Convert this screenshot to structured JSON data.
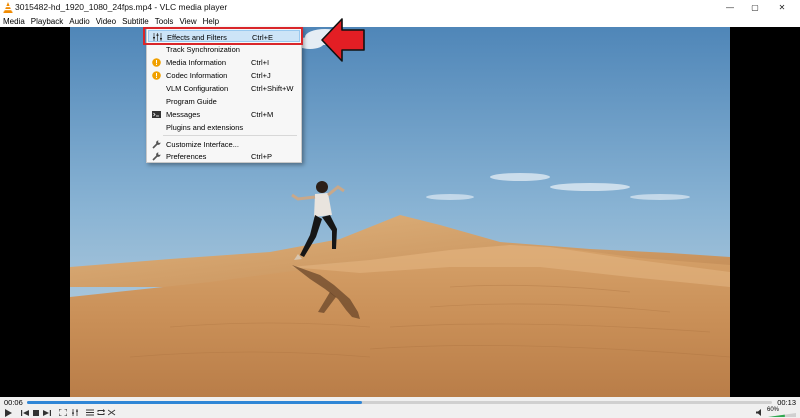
{
  "window": {
    "title": "3015482-hd_1920_1080_24fps.mp4 - VLC media player",
    "minimize_glyph": "—",
    "maximize_glyph": "▢",
    "close_glyph": "✕"
  },
  "menubar": {
    "items": [
      "Media",
      "Playback",
      "Audio",
      "Video",
      "Subtitle",
      "Tools",
      "View",
      "Help"
    ]
  },
  "tools_menu": {
    "items": [
      {
        "label": "Effects and Filters",
        "shortcut": "Ctrl+E",
        "icon": "equalizer-sliders-icon",
        "highlighted": true
      },
      {
        "label": "Track Synchronization",
        "shortcut": "",
        "icon": ""
      },
      {
        "label": "Media Information",
        "shortcut": "Ctrl+I",
        "icon": "info-icon"
      },
      {
        "label": "Codec Information",
        "shortcut": "Ctrl+J",
        "icon": "info-icon"
      },
      {
        "label": "VLM Configuration",
        "shortcut": "Ctrl+Shift+W",
        "icon": ""
      },
      {
        "label": "Program Guide",
        "shortcut": "",
        "icon": ""
      },
      {
        "label": "Messages",
        "shortcut": "Ctrl+M",
        "icon": "messages-terminal-icon"
      },
      {
        "label": "Plugins and extensions",
        "shortcut": "",
        "icon": ""
      },
      {
        "label": "Customize Interface...",
        "shortcut": "",
        "icon": "wrench-icon"
      },
      {
        "label": "Preferences",
        "shortcut": "Ctrl+P",
        "icon": "wrench-icon"
      }
    ]
  },
  "playback": {
    "elapsed": "00:06",
    "total": "00:13",
    "progress_fraction": 0.45,
    "volume_label": "60%",
    "volume_fraction": 0.6
  },
  "colors": {
    "highlight_border": "#d9262a",
    "menu_highlight": "#cde4f7",
    "seek_fill": "#2f86d6",
    "info_icon": "#f0a000"
  }
}
